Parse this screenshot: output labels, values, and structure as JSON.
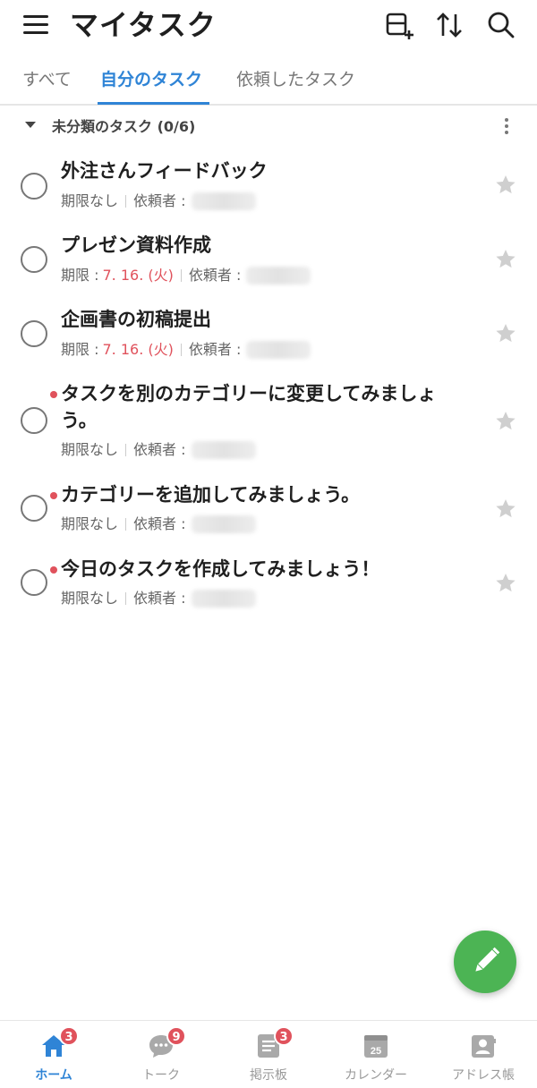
{
  "header": {
    "title": "マイタスク",
    "icons": [
      "menu-icon",
      "add-category-icon",
      "sort-icon",
      "search-icon"
    ]
  },
  "tabs": [
    {
      "label": "すべて",
      "active": false
    },
    {
      "label": "自分のタスク",
      "active": true
    },
    {
      "label": "依頼したタスク",
      "active": false
    }
  ],
  "category": {
    "label": "未分類のタスク (0/6)"
  },
  "tasks": [
    {
      "title": "外注さんフィードバック",
      "due_label": "期限なし",
      "due_date": "",
      "requester_label": "依頼者 :",
      "is_new": false
    },
    {
      "title": "プレゼン資料作成",
      "due_label": "期限 :",
      "due_date": "7. 16. (火)",
      "requester_label": "依頼者 :",
      "is_new": false
    },
    {
      "title": "企画書の初稿提出",
      "due_label": "期限 :",
      "due_date": "7. 16. (火)",
      "requester_label": "依頼者 :",
      "is_new": false
    },
    {
      "title": "タスクを別のカテゴリーに変更してみましょう。",
      "due_label": "期限なし",
      "due_date": "",
      "requester_label": "依頼者 :",
      "is_new": true
    },
    {
      "title": "カテゴリーを追加してみましょう。",
      "due_label": "期限なし",
      "due_date": "",
      "requester_label": "依頼者 :",
      "is_new": true
    },
    {
      "title": "今日のタスクを作成してみましょう！",
      "due_label": "期限なし",
      "due_date": "",
      "requester_label": "依頼者 :",
      "is_new": true
    }
  ],
  "bottom_nav": [
    {
      "label": "ホーム",
      "badge": "3",
      "active": true,
      "icon": "home-icon"
    },
    {
      "label": "トーク",
      "badge": "9",
      "active": false,
      "icon": "chat-icon"
    },
    {
      "label": "掲示板",
      "badge": "3",
      "active": false,
      "icon": "board-icon"
    },
    {
      "label": "カレンダー",
      "badge": "",
      "active": false,
      "icon": "calendar-icon",
      "icon_text": "25"
    },
    {
      "label": "アドレス帳",
      "badge": "",
      "active": false,
      "icon": "address-book-icon"
    }
  ],
  "colors": {
    "accent": "#2f84d6",
    "due": "#e0525c",
    "fab": "#4cb454",
    "badge": "#e0525c"
  }
}
